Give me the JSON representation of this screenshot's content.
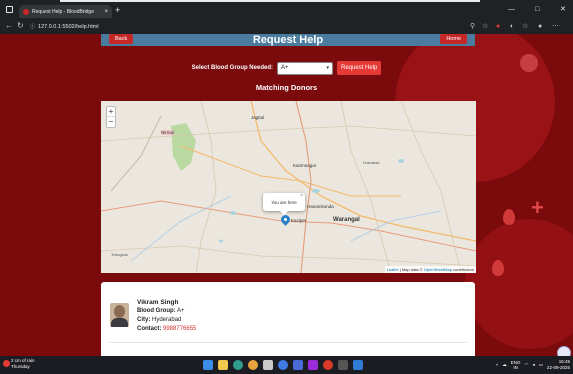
{
  "browser": {
    "tab_title": "Request Help - BloodBridge",
    "tab_close": "×",
    "new_tab": "+",
    "url": "127.0.0.1:5502/help.html",
    "win_min": "—",
    "win_max": "□",
    "win_close": "✕"
  },
  "header": {
    "title": "Request Help",
    "back_label": "Back",
    "home_label": "Home",
    "color": "#4a7ca0"
  },
  "request_form": {
    "label": "Select Blood Group Needed:",
    "selected": "A+",
    "button": "Request Help"
  },
  "matching_title": "Matching Donors",
  "map": {
    "zoom_in": "+",
    "zoom_out": "−",
    "popup_text": "You are here",
    "popup_close": "×",
    "attribution_leaflet": "Leaflet",
    "attribution_text": "| Map data ©",
    "attribution_osm": "OpenStreetMap",
    "attribution_contributors": "contributors",
    "labels": {
      "nirmal": "Nirmal",
      "jagtial": "Jagtial",
      "karimnagar": "Karimnagar",
      "hanamkonda": "Hanamkonda",
      "kazipet": "Kazipet",
      "warangal": "Warangal",
      "husnabad": "Husnabad",
      "telangana": "Telangana"
    }
  },
  "donor": {
    "name": "Vikram Singh",
    "blood_label": "Blood Group:",
    "blood_value": "A+",
    "city_label": "City:",
    "city_value": "Hyderabad",
    "contact_label": "Contact:",
    "contact_value": "9988776655"
  },
  "taskbar": {
    "weather_line1": "2 cm of rain",
    "weather_line2": "Thursday",
    "lang_line1": "ENG",
    "lang_line2": "IN",
    "time": "15:45",
    "date": "22-09-2025",
    "chevron": "^"
  },
  "colors": {
    "page_bg": "#7a0a0c",
    "accent_red": "#e53935"
  }
}
